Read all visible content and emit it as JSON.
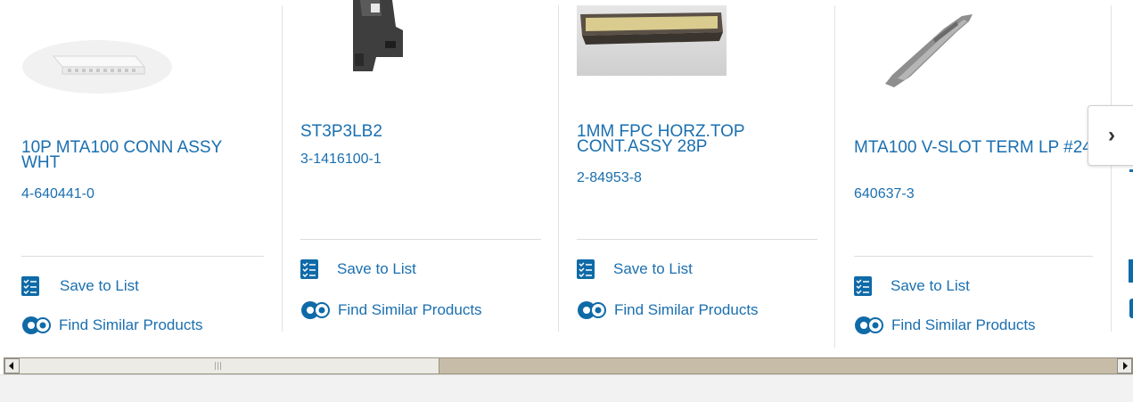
{
  "products": [
    {
      "title": "10P MTA100 CONN ASSY WHT",
      "part_number": "4-640441-0",
      "image_icon": "white-connector-image"
    },
    {
      "title": "ST3P3LB2",
      "part_number": "3-1416100-1",
      "image_icon": "relay-module-image"
    },
    {
      "title": "1MM FPC HORZ.TOP CONT.ASSY 28P",
      "part_number": "2-84953-8",
      "image_icon": "fpc-connector-image"
    },
    {
      "title": "MTA100 V-SLOT TERM LP #24",
      "part_number": "640637-3",
      "image_icon": "terminal-clip-image"
    }
  ],
  "actions": {
    "save_label": "Save to List",
    "similar_label": "Find Similar Products"
  },
  "carousel": {
    "next_icon": "chevron-right-icon",
    "next_glyph": "›"
  },
  "colors": {
    "link": "#1a6fb0",
    "icon_bg": "#0f6aa8",
    "scroll_track": "#c7bca8",
    "scroll_thumb": "#ecebe6"
  }
}
